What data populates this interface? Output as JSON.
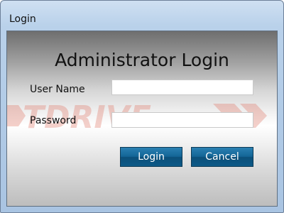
{
  "window": {
    "title": "Login"
  },
  "form": {
    "heading": "Administrator Login",
    "username_label": "User Name",
    "username_value": "",
    "password_label": "Password",
    "password_value": ""
  },
  "buttons": {
    "login_label": "Login",
    "cancel_label": "Cancel"
  },
  "watermark": {
    "text": "TDRIVE"
  },
  "colors": {
    "button": "#136596",
    "watermark": "#e07a6a"
  }
}
